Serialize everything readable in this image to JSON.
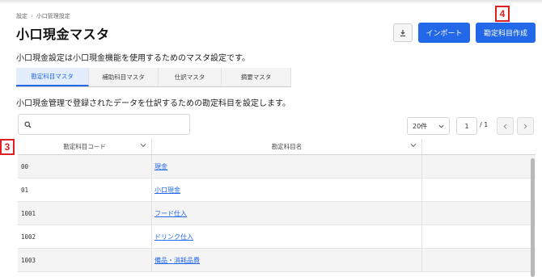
{
  "breadcrumb": {
    "items": [
      "設定",
      "小口管理設定"
    ],
    "separator": "›"
  },
  "page": {
    "title": "小口現金マスタ",
    "description": "小口現金設定は小口現金機能を使用するためのマスタ設定です。",
    "sub_description": "小口現金管理で登録されたデータを仕訳するための勘定科目を設定します。"
  },
  "header_actions": {
    "download_icon": "download-icon",
    "import_label": "インポート",
    "create_label": "勘定科目作成"
  },
  "callouts": {
    "top_right": "4",
    "table_left": "3",
    "color": "#e02020"
  },
  "tabs": [
    {
      "label": "勘定科目マスタ",
      "active": true
    },
    {
      "label": "補助科目マスタ",
      "active": false
    },
    {
      "label": "仕訳マスタ",
      "active": false
    },
    {
      "label": "摘要マスタ",
      "active": false
    }
  ],
  "search": {
    "icon": "search-icon",
    "placeholder": ""
  },
  "pagination": {
    "per_page": "20件",
    "current_page": "1",
    "total": "/ 1",
    "prev_icon": "chevron-left-icon",
    "next_icon": "chevron-right-icon"
  },
  "table": {
    "columns": [
      {
        "label": "勘定科目コード"
      },
      {
        "label": "勘定科目名"
      }
    ],
    "rows": [
      {
        "code": "00",
        "name": "現金"
      },
      {
        "code": "01",
        "name": "小口現金"
      },
      {
        "code": "1001",
        "name": "フード仕入"
      },
      {
        "code": "1002",
        "name": "ドリンク仕入"
      },
      {
        "code": "1003",
        "name": "備品・消耗品費"
      }
    ]
  },
  "colors": {
    "accent": "#2368e8",
    "active_tab_bg": "#e3edfb",
    "alt_row": "#f4f4f4"
  }
}
